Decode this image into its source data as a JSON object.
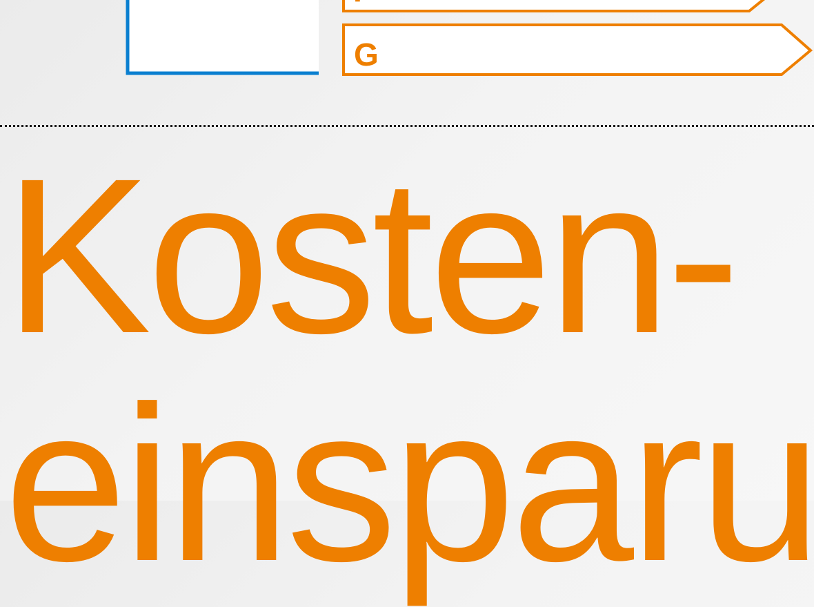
{
  "energy_label": {
    "classes": [
      "F",
      "G"
    ]
  },
  "headline": {
    "line1": "Kosten-",
    "line2": "einsparu"
  },
  "colors": {
    "accent_orange": "#ee7f00",
    "border_blue": "#0a7fd0",
    "background": "#f3f3f3",
    "divider": "#1a1a1a"
  }
}
